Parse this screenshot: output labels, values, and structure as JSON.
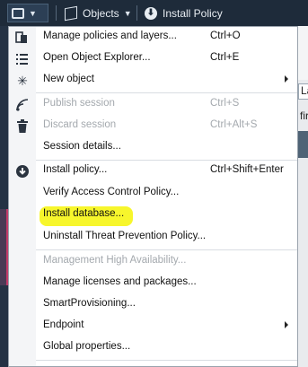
{
  "toolbar": {
    "objects_label": "Objects",
    "install_policy_label": "Install Policy"
  },
  "background": {
    "field_fragment": "La",
    "text_fragment": "first"
  },
  "menu": {
    "items": [
      {
        "label": "Manage policies and layers...",
        "shortcut": "Ctrl+O",
        "icon": "policy-layers-icon",
        "disabled": false
      },
      {
        "label": "Open Object Explorer...",
        "shortcut": "Ctrl+E",
        "icon": "list-icon",
        "disabled": false
      },
      {
        "label": "New object",
        "shortcut": "",
        "icon": "new-object-icon",
        "disabled": false,
        "submenu": true
      },
      {
        "label": "Publish session",
        "shortcut": "Ctrl+S",
        "icon": "publish-icon",
        "disabled": true
      },
      {
        "label": "Discard session",
        "shortcut": "Ctrl+Alt+S",
        "icon": "trash-icon",
        "disabled": true
      },
      {
        "label": "Session details...",
        "shortcut": "",
        "icon": "",
        "disabled": false
      },
      {
        "label": "Install policy...",
        "shortcut": "Ctrl+Shift+Enter",
        "icon": "install-icon",
        "disabled": false
      },
      {
        "label": "Verify Access Control Policy...",
        "shortcut": "",
        "icon": "",
        "disabled": false
      },
      {
        "label": "Install database...",
        "shortcut": "",
        "icon": "",
        "disabled": false,
        "highlighted": true
      },
      {
        "label": "Uninstall Threat Prevention Policy...",
        "shortcut": "",
        "icon": "",
        "disabled": false
      },
      {
        "label": "Management High Availability...",
        "shortcut": "",
        "icon": "",
        "disabled": true
      },
      {
        "label": "Manage licenses and packages...",
        "shortcut": "",
        "icon": "",
        "disabled": false
      },
      {
        "label": "SmartProvisioning...",
        "shortcut": "",
        "icon": "",
        "disabled": false
      },
      {
        "label": "Endpoint",
        "shortcut": "",
        "icon": "",
        "disabled": false,
        "submenu": true
      },
      {
        "label": "Global properties...",
        "shortcut": "",
        "icon": "",
        "disabled": false
      }
    ]
  },
  "colors": {
    "toolbar_bg": "#1e2b3a",
    "highlight": "#f6f51a",
    "disabled_text": "#a4a9ae"
  }
}
